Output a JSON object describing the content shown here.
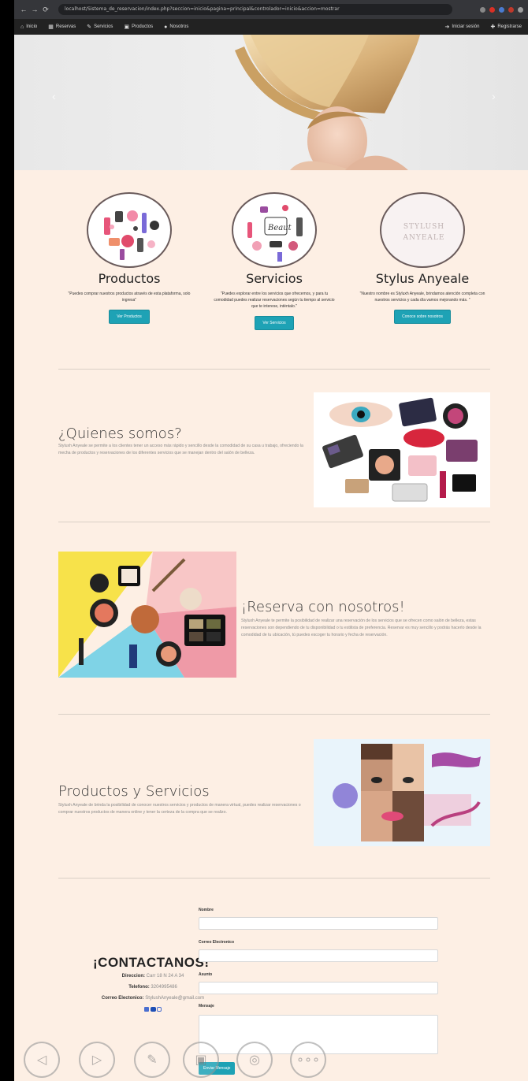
{
  "browser": {
    "url": "localhost/Sistema_de_reservacion/index.php?seccion=inicio&pagina=principal&controlador=inicio&accion=mostrar"
  },
  "nav": {
    "items": [
      {
        "icon": "home-icon",
        "label": "Inicio"
      },
      {
        "icon": "calendar-icon",
        "label": "Reservas"
      },
      {
        "icon": "brush-icon",
        "label": "Servicios"
      },
      {
        "icon": "box-icon",
        "label": "Productos"
      },
      {
        "icon": "user-icon",
        "label": "Nosotros"
      }
    ],
    "right": [
      {
        "icon": "login-icon",
        "label": "Iniciar sesión"
      },
      {
        "icon": "register-icon",
        "label": "Registrarse"
      }
    ]
  },
  "features": [
    {
      "title": "Productos",
      "text": "\"Puedes comprar nuestros productos através de esta plataforma, solo ingresa\"",
      "button": "Ver Productos"
    },
    {
      "title": "Servicios",
      "text": "\"Puedes explorar entre los servicios que ofrecemos, y para tu comodidad puedes realizar reservaciones según tu tiempo al servicio que te interese, inténtalo.\"",
      "button": "Ver Servicios"
    },
    {
      "title": "Stylus Anyeale",
      "text": "\"Nuestro nombre es Styluxh Anyeale, brindamos atención completa con nuestros servicios y cada día vamos mejorando más. \"",
      "button": "Conoce sobre nosotros",
      "logo_text": "STYLUSH ANYEALE"
    }
  ],
  "sections": {
    "about": {
      "title": "¿Quienes somos?",
      "text": "Styluxh Anyeale se permite a los clientes tener un acceso más rápido y sencillo desde la comodidad de su casa u trabajo, ofreciendo la mecha de productos y reservaciones de los diferentes servicios que se manejan dentro del salón de belleza."
    },
    "booking": {
      "title": "¡Reserva con nosotros!",
      "text": "Styluxh Anyeale te permite la posibilidad de realizar una reservación de los servicios que se ofrecen como salón de belleza, estas reservaciones son dependiendo de tu disponibilidad o tu estilista de preferencia. Reservar es muy sencillo y podrás hacerlo desde la comodidad de tu ubicación, tú puedes escoger tu horario y fecha de reservación."
    },
    "products": {
      "title": "Productos y Servicios",
      "text": "Styluxh Anyeale de brinda la posibilidad de conocer nuestros servicios y productos de manera virtual, puedes realizar reservaciones o comprar nuestros productos de manera online y tener la certeza de la compra que se realizo."
    }
  },
  "contact": {
    "title": "¡CONTACTANOS!",
    "direccion_label": "Direccion:",
    "direccion": "Carr 18 N 24 A 34",
    "telefono_label": "Telefono:",
    "telefono": "3204995486",
    "correo_label": "Correo Electonico:",
    "correo": "StylushAnyeale@gmail.com",
    "form": {
      "nombre": "Nombre",
      "correo": "Correo Electronico",
      "asunto": "Asunto",
      "mensaje": "Mensaje",
      "send": "Enviar Mensaje"
    }
  },
  "colors": {
    "background": "#fdefe4",
    "accent": "#1ea2b5",
    "navbar": "#222222"
  }
}
